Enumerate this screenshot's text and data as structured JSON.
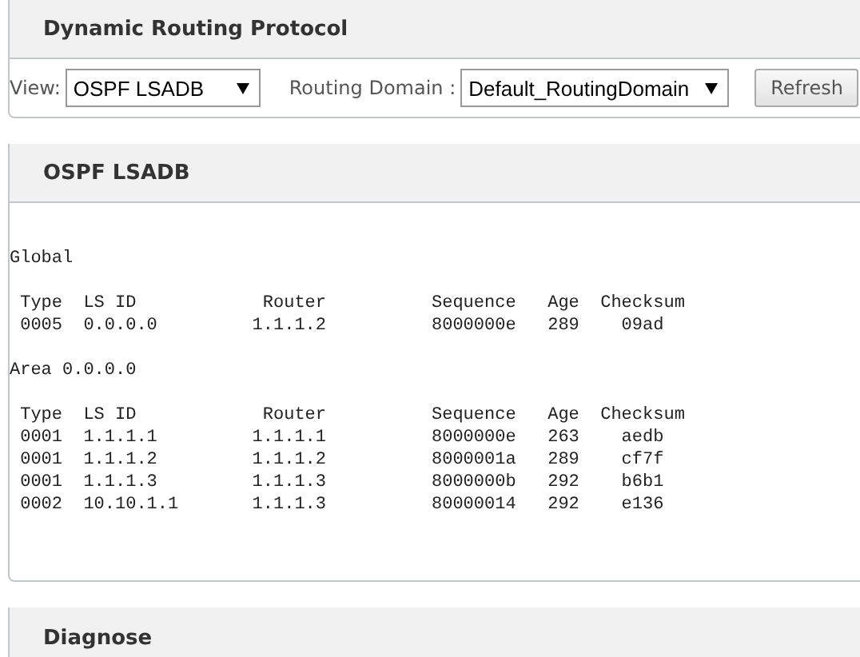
{
  "panels": [
    {
      "kind": "controls",
      "title": "Dynamic Routing Protocol",
      "view": {
        "label": "View:",
        "value": "OSPF LSADB"
      },
      "domain": {
        "label": "Routing Domain :",
        "value": "Default_RoutingDomain"
      },
      "button": "Refresh"
    },
    {
      "kind": "output",
      "title": "OSPF LSADB",
      "sections": [
        {
          "heading": "Global",
          "columns": [
            "Type",
            "LS ID",
            "Router",
            "Sequence",
            "Age",
            "Checksum"
          ],
          "rows": [
            [
              "0005",
              "0.0.0.0",
              "1.1.1.2",
              "8000000e",
              "289",
              "09ad"
            ]
          ]
        },
        {
          "heading": "Area 0.0.0.0",
          "columns": [
            "Type",
            "LS ID",
            "Router",
            "Sequence",
            "Age",
            "Checksum"
          ],
          "rows": [
            [
              "0001",
              "1.1.1.1",
              "1.1.1.1",
              "8000000e",
              "263",
              "aedb"
            ],
            [
              "0001",
              "1.1.1.2",
              "1.1.1.2",
              "8000001a",
              "289",
              "cf7f"
            ],
            [
              "0001",
              "1.1.1.3",
              "1.1.1.3",
              "8000000b",
              "292",
              "b6b1"
            ],
            [
              "0002",
              "10.10.1.1",
              "1.1.1.3",
              "80000014",
              "292",
              "e136"
            ]
          ]
        }
      ]
    },
    {
      "kind": "header",
      "title": "Diagnose"
    }
  ]
}
